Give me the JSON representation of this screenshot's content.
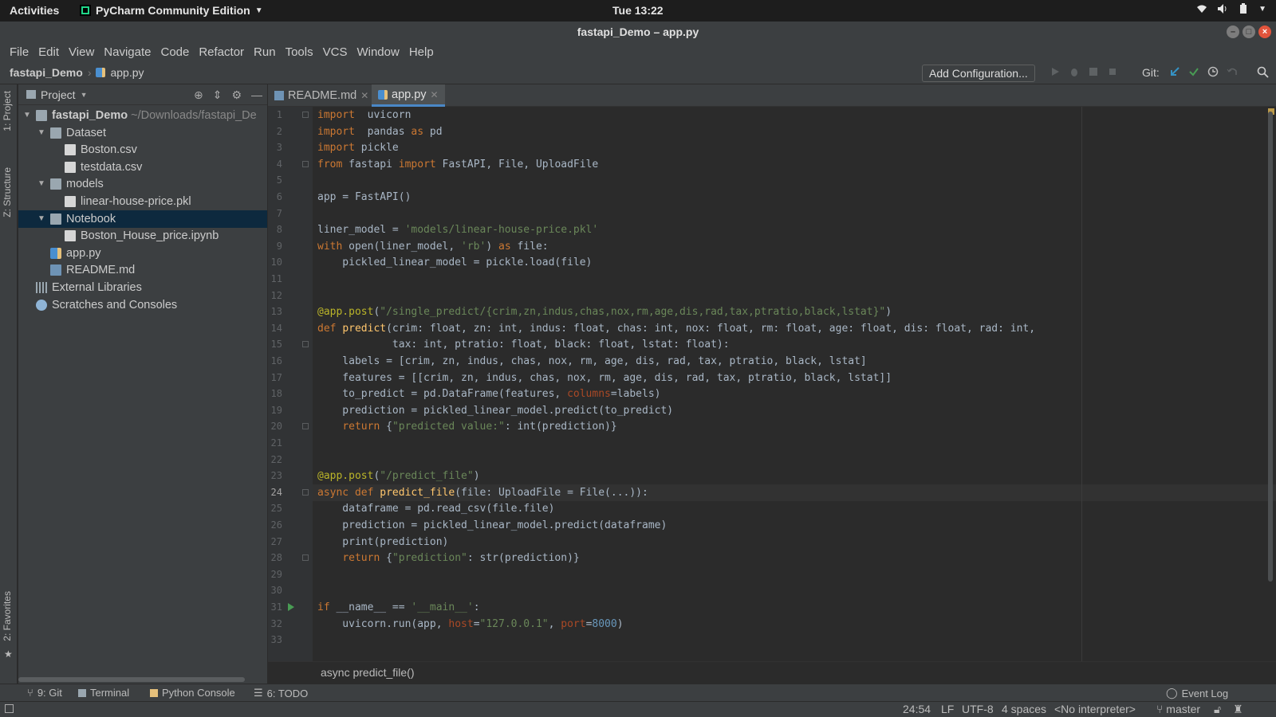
{
  "system": {
    "activities": "Activities",
    "app_name": "PyCharm Community Edition",
    "clock": "Tue 13:22"
  },
  "window": {
    "title": "fastapi_Demo – app.py"
  },
  "menu": [
    {
      "label": "File"
    },
    {
      "label": "Edit"
    },
    {
      "label": "View"
    },
    {
      "label": "Navigate"
    },
    {
      "label": "Code"
    },
    {
      "label": "Refactor"
    },
    {
      "label": "Run"
    },
    {
      "label": "Tools"
    },
    {
      "label": "VCS"
    },
    {
      "label": "Window"
    },
    {
      "label": "Help"
    }
  ],
  "navbar": {
    "project": "fastapi_Demo",
    "file": "app.py",
    "add_configuration": "Add Configuration...",
    "git_label": "Git:"
  },
  "left_stripe": {
    "project": "1: Project",
    "structure": "Z: Structure",
    "favorites": "2: Favorites"
  },
  "project_panel": {
    "title": "Project",
    "tree": [
      {
        "label": "fastapi_Demo",
        "path": "~/Downloads/fastapi_De",
        "type": "folder",
        "depth": 0,
        "expanded": true
      },
      {
        "label": "Dataset",
        "type": "folder",
        "depth": 1,
        "expanded": true
      },
      {
        "label": "Boston.csv",
        "type": "csv",
        "depth": 2
      },
      {
        "label": "testdata.csv",
        "type": "csv",
        "depth": 2
      },
      {
        "label": "models",
        "type": "folder",
        "depth": 1,
        "expanded": true
      },
      {
        "label": "linear-house-price.pkl",
        "type": "file",
        "depth": 2
      },
      {
        "label": "Notebook",
        "type": "folder",
        "depth": 1,
        "expanded": true,
        "selected": true
      },
      {
        "label": "Boston_House_price.ipynb",
        "type": "file",
        "depth": 2
      },
      {
        "label": "app.py",
        "type": "py",
        "depth": 1
      },
      {
        "label": "README.md",
        "type": "md",
        "depth": 1
      },
      {
        "label": "External Libraries",
        "type": "lib",
        "depth": 0
      },
      {
        "label": "Scratches and Consoles",
        "type": "scratch",
        "depth": 0
      }
    ]
  },
  "tabs": [
    {
      "label": "README.md",
      "active": false
    },
    {
      "label": "app.py",
      "active": true
    }
  ],
  "editor": {
    "current_line": 24,
    "lines": [
      [
        [
          "kw",
          "import"
        ],
        [
          "",
          "  uvicorn"
        ]
      ],
      [
        [
          "kw",
          "import"
        ],
        [
          "",
          "  pandas "
        ],
        [
          "kw",
          "as"
        ],
        [
          "",
          " pd"
        ]
      ],
      [
        [
          "kw",
          "import"
        ],
        [
          "",
          " pickle"
        ]
      ],
      [
        [
          "kw",
          "from"
        ],
        [
          "",
          " fastapi "
        ],
        [
          "kw",
          "import"
        ],
        [
          "",
          " FastAPI, File, UploadFile"
        ]
      ],
      [],
      [
        [
          "",
          "app = FastAPI()"
        ]
      ],
      [],
      [
        [
          "",
          "liner_model = "
        ],
        [
          "str",
          "'models/linear-house-price.pkl'"
        ]
      ],
      [
        [
          "kw",
          "with"
        ],
        [
          "",
          " open(liner_model, "
        ],
        [
          "str",
          "'rb'"
        ],
        [
          "",
          ") "
        ],
        [
          "kw",
          "as"
        ],
        [
          "",
          " file:"
        ]
      ],
      [
        [
          "",
          "    pickled_linear_model = pickle.load(file)"
        ]
      ],
      [],
      [],
      [
        [
          "dec",
          "@app.post"
        ],
        [
          "",
          "("
        ],
        [
          "str",
          "\"/single_predict/{crim,zn,indus,chas,nox,rm,age,dis,rad,tax,ptratio,black,lstat}\""
        ],
        [
          "",
          ")"
        ]
      ],
      [
        [
          "kw",
          "def"
        ],
        [
          "",
          " "
        ],
        [
          "fn",
          "predict"
        ],
        [
          "",
          "(crim: float, zn: int, indus: float, chas: int, nox: float, rm: float, age: float, dis: float, rad: int,"
        ]
      ],
      [
        [
          "",
          "            tax: int, ptratio: float, black: float, lstat: float):"
        ]
      ],
      [
        [
          "",
          "    labels = [crim, zn, indus, chas, nox, rm, age, dis, rad, tax, ptratio, black, lstat]"
        ]
      ],
      [
        [
          "",
          "    features = [[crim, zn, indus, chas, nox, rm, age, dis, rad, tax, ptratio, black, lstat]]"
        ]
      ],
      [
        [
          "",
          "    to_predict = pd.DataFrame(features, "
        ],
        [
          "kwa",
          "columns"
        ],
        [
          "",
          "=labels)"
        ]
      ],
      [
        [
          "",
          "    prediction = pickled_linear_model.predict(to_predict)"
        ]
      ],
      [
        [
          "",
          "    "
        ],
        [
          "kw",
          "return"
        ],
        [
          "",
          " {"
        ],
        [
          "str",
          "\"predicted value:\""
        ],
        [
          "",
          ": int(prediction)}"
        ]
      ],
      [],
      [],
      [
        [
          "dec",
          "@app.post"
        ],
        [
          "",
          "("
        ],
        [
          "str",
          "\"/predict_file\""
        ],
        [
          "",
          ")"
        ]
      ],
      [
        [
          "kw",
          "async def"
        ],
        [
          "",
          " "
        ],
        [
          "fn",
          "predict_file"
        ],
        [
          "",
          "(file: UploadFile = File(...)):"
        ]
      ],
      [
        [
          "",
          "    dataframe = pd.read_csv(file.file)"
        ]
      ],
      [
        [
          "",
          "    prediction = pickled_linear_model.predict(dataframe)"
        ]
      ],
      [
        [
          "",
          "    print(prediction)"
        ]
      ],
      [
        [
          "",
          "    "
        ],
        [
          "kw",
          "return"
        ],
        [
          "",
          " {"
        ],
        [
          "str",
          "\"prediction\""
        ],
        [
          "",
          ": str(prediction)}"
        ]
      ],
      [],
      [],
      [
        [
          "kw",
          "if"
        ],
        [
          "",
          " __name__ == "
        ],
        [
          "str",
          "'__main__'"
        ],
        [
          "",
          ":"
        ]
      ],
      [
        [
          "",
          "    uvicorn.run(app, "
        ],
        [
          "kwa",
          "host"
        ],
        [
          "",
          "="
        ],
        [
          "str",
          "\"127.0.0.1\""
        ],
        [
          "",
          ", "
        ],
        [
          "kwa",
          "port"
        ],
        [
          "",
          "="
        ],
        [
          "num",
          "8000"
        ],
        [
          "",
          ")"
        ]
      ],
      []
    ]
  },
  "editor_breadcrumb": "async predict_file()",
  "tool_windows": {
    "git": "9: Git",
    "terminal": "Terminal",
    "python_console": "Python Console",
    "todo": "6: TODO",
    "event_log": "Event Log"
  },
  "status": {
    "position": "24:54",
    "line_sep": "LF",
    "encoding": "UTF-8",
    "indent": "4 spaces",
    "interpreter": "<No interpreter>",
    "branch": "master"
  },
  "colors": {
    "keyword": "#cc7832",
    "string": "#6a8759",
    "decorator": "#bbb529",
    "function": "#ffc66d",
    "number": "#6897bb",
    "selection": "#0d293e",
    "tab_accent": "#4a88c7"
  }
}
